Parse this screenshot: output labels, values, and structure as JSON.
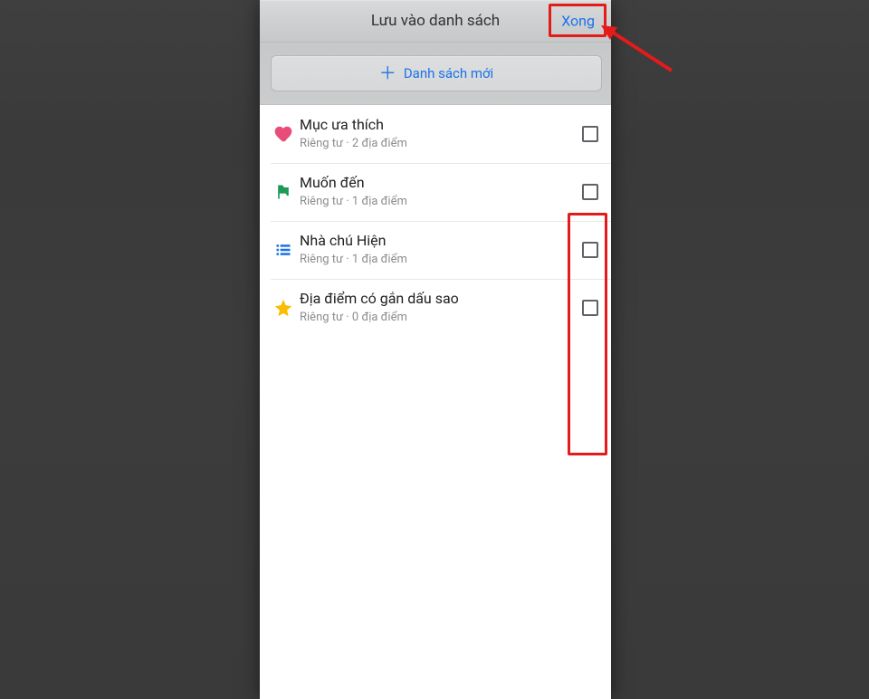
{
  "header": {
    "title": "Lưu vào danh sách",
    "done": "Xong"
  },
  "newlist": {
    "label": "Danh sách mới"
  },
  "lists": [
    {
      "icon": "heart",
      "title": "Mục ưa thích",
      "sub": "Riêng tư · 2 địa điểm"
    },
    {
      "icon": "flag",
      "title": "Muốn đến",
      "sub": "Riêng tư · 1 địa điểm"
    },
    {
      "icon": "listbars",
      "title": "Nhà chú Hiện",
      "sub": "Riêng tư · 1 địa điểm"
    },
    {
      "icon": "star",
      "title": "Địa điểm có gắn dấu sao",
      "sub": "Riêng tư · 0 địa điểm"
    }
  ],
  "annotations": {
    "highlight_done": true,
    "highlight_checkbox_column": true,
    "arrow_to_done": true
  }
}
